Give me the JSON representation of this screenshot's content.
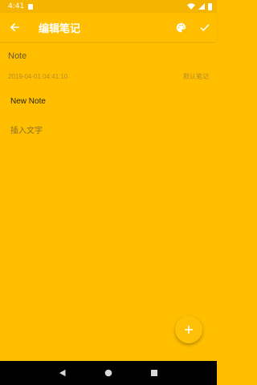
{
  "status_bar": {
    "time": "4:41",
    "icons": [
      "sd-card-icon",
      "wifi-icon",
      "signal-icon",
      "battery-icon"
    ]
  },
  "toolbar": {
    "title": "编辑笔记",
    "back_icon": "arrow-back-icon",
    "palette_icon": "palette-icon",
    "confirm_icon": "check-icon"
  },
  "note": {
    "title": "Note",
    "timestamp": "2019-04-01 04:41:10",
    "category": "默认笔记",
    "heading": "New Note",
    "body_placeholder": "插入文字"
  },
  "fab": {
    "icon": "plus-icon"
  },
  "nav_bar": {
    "icons": [
      "back-triangle-icon",
      "home-circle-icon",
      "recents-square-icon"
    ]
  },
  "colors": {
    "background": "#FFBF00",
    "status_bar": "#F4B400",
    "fab": "#FFC107",
    "timestamp_text": "#B58B2A",
    "nav_bar": "#000000"
  }
}
